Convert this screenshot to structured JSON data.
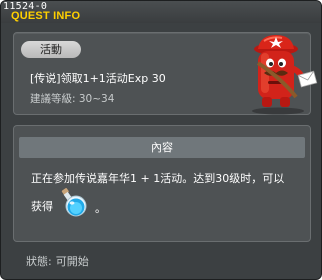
{
  "window": {
    "quest_id": "11524-0",
    "title": "QUEST INFO"
  },
  "quest": {
    "category_badge": "活動",
    "name": "[传说]领取1+1活动Exp 30",
    "level_requirement": "建議等級: 30~34"
  },
  "content": {
    "header": "內容",
    "description_line1": "正在参加传说嘉年华1 + 1活动。达到30级时，可以",
    "description_line2": "获得",
    "description_end": "。",
    "reward_item_icon": "blue-potion-icon"
  },
  "status": {
    "label": "狀態:",
    "value": "可開始"
  },
  "colors": {
    "title": "#ffd000",
    "background": "#3c4042",
    "panel": "#4e5254",
    "header_bar": "#70777b"
  },
  "npc_icon": "red-mailbox-npc-icon"
}
